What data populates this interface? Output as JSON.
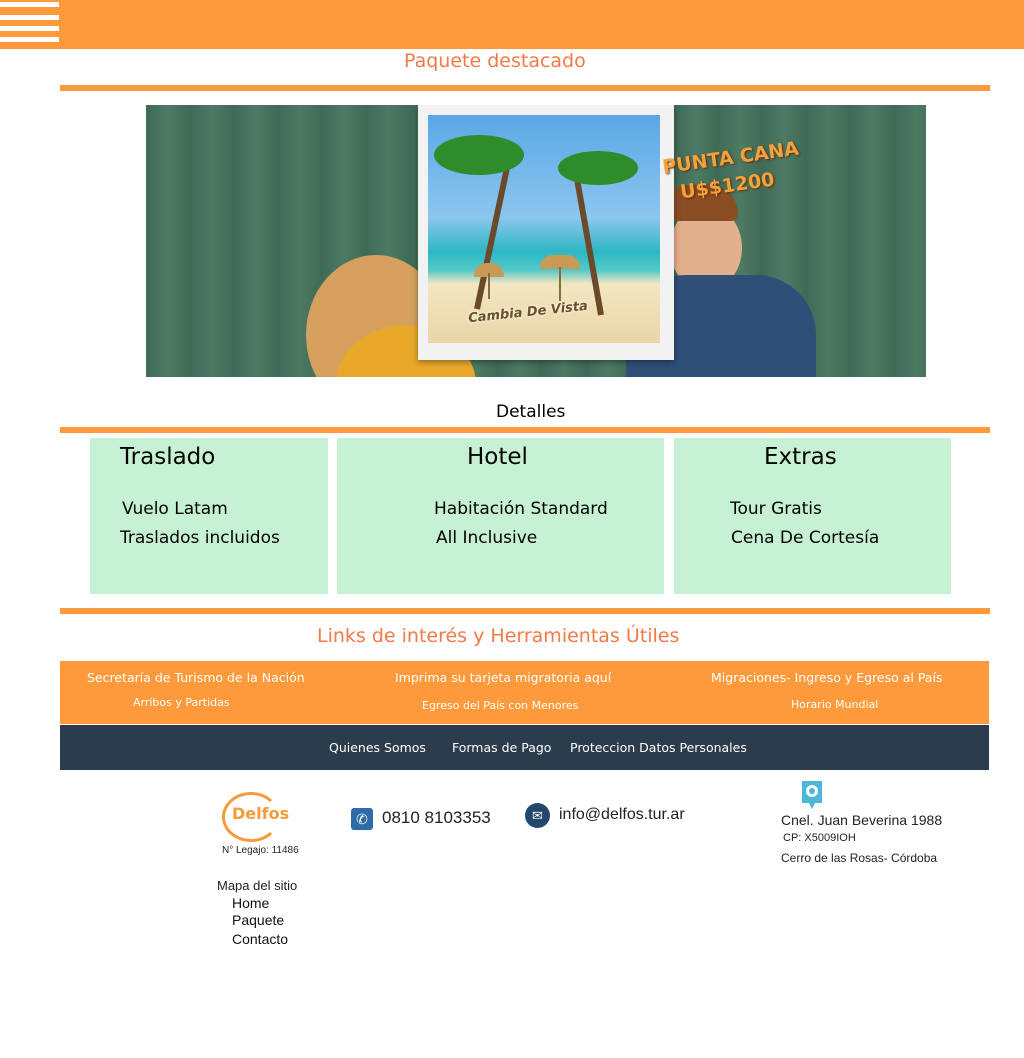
{
  "header": {
    "menu_icon": "hamburger-menu-icon",
    "accent_color": "#ff9a3c"
  },
  "featured": {
    "title": "Paquete destacado",
    "banner": {
      "destination": "PUNTA CANA",
      "price": "U$$1200",
      "slogan": "Cambia De Vista"
    }
  },
  "details": {
    "title": "Detalles",
    "cards": [
      {
        "title": "Traslado",
        "items": [
          "Vuelo Latam",
          "Traslados incluidos"
        ]
      },
      {
        "title": "Hotel",
        "items": [
          "Habitación Standard",
          "All Inclusive"
        ]
      },
      {
        "title": "Extras",
        "items": [
          "Tour Gratis",
          "Cena De Cortesía"
        ]
      }
    ],
    "card_color": "#c6f2d3"
  },
  "links": {
    "title": "Links de interés y Herramientas Útiles",
    "items": [
      "Secretaría de Turismo de la Nación",
      "Imprima su tarjeta migratoria aquí",
      "Migraciones- Ingreso y Egreso al País",
      "Arribos y Partidas",
      "Egreso del País con Menores",
      "Horario Mundial"
    ]
  },
  "nav": {
    "items": [
      "Quienes Somos",
      "Formas de Pago",
      "Proteccion Datos Personales"
    ],
    "bg_color": "#2b3c4c"
  },
  "footer": {
    "logo_text": "Delfos",
    "legajo": "N° Legajo: 11486",
    "phone": "0810 8103353",
    "email": "info@delfos.tur.ar",
    "address": {
      "street": "Cnel. Juan Beverina 1988",
      "cp": "CP: X5009IOH",
      "area": "Cerro de las Rosas- Córdoba"
    },
    "sitemap": {
      "title": "Mapa del sitio",
      "items": [
        "Home",
        "Paquete",
        "Contacto"
      ]
    },
    "icons": {
      "phone": "phone-icon",
      "email": "email-icon",
      "location": "location-pin-icon"
    }
  }
}
